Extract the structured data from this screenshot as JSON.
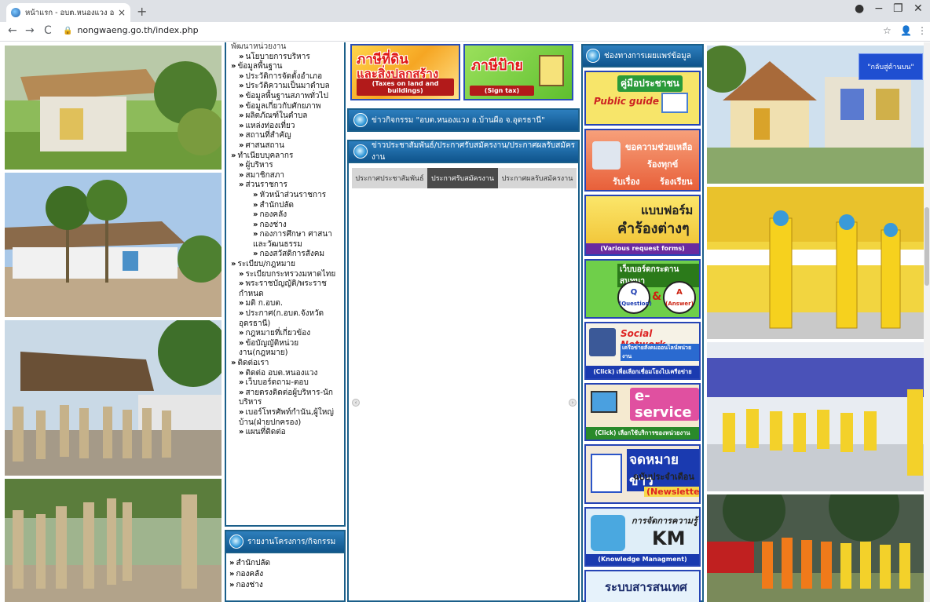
{
  "browser": {
    "tab_title": "หน้าแรก - อบต.หนองแวง อ.บ้านผือ จ.",
    "tab_close": "×",
    "new_tab": "+",
    "url": "nongwaeng.go.th/index.php",
    "min": "−",
    "restore": "❐",
    "close": "✕",
    "back": "←",
    "forward": "→",
    "reload": "C",
    "star": "☆",
    "more": "⋮"
  },
  "menu": {
    "items": [
      {
        "level": 1,
        "label": "นโยบายการบริหาร"
      },
      {
        "level": 0,
        "label": "ข้อมูลพื้นฐาน"
      },
      {
        "level": 1,
        "label": "ประวัติการจัดตั้งอำเภอ"
      },
      {
        "level": 1,
        "label": "ประวัติความเป็นมาตำบล"
      },
      {
        "level": 1,
        "label": "ข้อมูลพื้นฐานสภาพทั่วไป"
      },
      {
        "level": 1,
        "label": "ข้อมูลเกี่ยวกับศักยภาพ"
      },
      {
        "level": 1,
        "label": "ผลิตภัณฑ์ในตำบล"
      },
      {
        "level": 1,
        "label": "แหล่งท่องเที่ยว"
      },
      {
        "level": 1,
        "label": "สถานที่สำคัญ"
      },
      {
        "level": 1,
        "label": "ศาสนสถาน"
      },
      {
        "level": 0,
        "label": "ทำเนียบบุคลากร"
      },
      {
        "level": 1,
        "label": "ผู้บริหาร"
      },
      {
        "level": 1,
        "label": "สมาชิกสภา"
      },
      {
        "level": 1,
        "label": "ส่วนราชการ"
      },
      {
        "level": 2,
        "label": "หัวหน้าส่วนราชการ"
      },
      {
        "level": 2,
        "label": "สำนักปลัด"
      },
      {
        "level": 2,
        "label": "กองคลัง"
      },
      {
        "level": 2,
        "label": "กองช่าง"
      },
      {
        "level": 2,
        "label": "กองการศึกษา ศาสนาและวัฒนธรรม"
      },
      {
        "level": 2,
        "label": "กองสวัสดิการสังคม"
      },
      {
        "level": 0,
        "label": "ระเบียบ/กฎหมาย"
      },
      {
        "level": 1,
        "label": "ระเบียบกระทรวงมหาดไทย"
      },
      {
        "level": 1,
        "label": "พระราชบัญญัติ/พระราชกำหนด"
      },
      {
        "level": 1,
        "label": "มติ ก.อบต."
      },
      {
        "level": 1,
        "label": "ประกาศ(ก.อบต.จังหวัดอุดรธานี)"
      },
      {
        "level": 1,
        "label": "กฎหมายที่เกี่ยวข้อง"
      },
      {
        "level": 1,
        "label": "ข้อบัญญัติหน่วยงาน(กฎหมาย)"
      },
      {
        "level": 0,
        "label": "ติดต่อเรา"
      },
      {
        "level": 1,
        "label": "ติดต่อ อบต.หนองแวง"
      },
      {
        "level": 1,
        "label": "เว็บบอร์ดถาม-ตอบ"
      },
      {
        "level": 1,
        "label": "สายตรงติดต่อผู้บริหาร-นักบริหาร"
      },
      {
        "level": 1,
        "label": "เบอร์โทรศัพท์กำนัน,ผู้ใหญ่บ้าน(ฝ่ายปกครอง)"
      },
      {
        "level": 1,
        "label": "แผนที่ติดต่อ"
      }
    ],
    "cut_top": "พัฒนาหน่วยงาน"
  },
  "menu2": {
    "title": "รายงานโครงการ/กิจกรรม",
    "items": [
      "สำนักปลัด",
      "กองคลัง",
      "กองช่าง"
    ]
  },
  "banners": {
    "tax_land_line1": "ภาษีที่ดิน",
    "tax_land_line2": "และสิ่งปลูกสร้าง",
    "tax_land_en": "(Taxes on land and buildings)",
    "tax_sign_th": "ภาษีป้าย",
    "tax_sign_en": "(Sign tax)"
  },
  "middle": {
    "activity_title": "ข่าวกิจกรรม \"อบต.หนองแวง อ.บ้านผือ จ.อุดรธานี\"",
    "pr_title": "ข่าวประชาสัมพันธ์/ประกาศรับสมัครงาน/ประกาศผลรับสมัครงาน",
    "tabs": [
      "ประกาศประชาสัมพันธ์",
      "ประกาศรับสมัครงาน",
      "ประกาศผลรับสมัครงาน"
    ],
    "active_tab": 1,
    "prev": "‹",
    "next": "›"
  },
  "right": {
    "title": "ช่องทางการเผยแพร่ข้อมูล",
    "public_guide_th": "คู่มือประชาชน",
    "public_guide_en": "Public guide",
    "help_title": "ขอความช่วยเหลือ",
    "help_1": "ร้องทุกข์",
    "help_2": "รับเรื่อง",
    "help_3": "ร้องเรียน",
    "form_title": "แบบฟอร์ม",
    "form_big": "คำร้องต่างๆ",
    "form_en": "(Various request forms)",
    "qa_title": "เว็บบอร์ดกระดานสนทนา",
    "qa_q": "Q",
    "qa_qe": "(Question)",
    "qa_amp": "&",
    "qa_a": "A",
    "qa_ae": "(Answer)",
    "social_title": "Social Network",
    "social_sub": "เครือข่ายสังคมออนไลน์หน่วยงาน",
    "social_click": "(Click) เพื่อเลือกเชื่อมโยงไปเครือข่าย",
    "eservice": "e-service",
    "eservice_click": "(Click) เลือกใช้บริการของหน่วยงาน",
    "news_title": "จดหมายข่าว",
    "news_sub": "ฉบับประจำเดือน",
    "news_en": "(Newsletter)",
    "km_title": "การจัดการความรู้",
    "km_big": "KM",
    "km_en": "(Knowledge Managment)",
    "info_title": "ระบบสารสนเทศ"
  },
  "gotop": "\"กลับสู่ด้านบน\"",
  "colors": {
    "header_blue": "#10568c",
    "border_blue": "#1b5f8a",
    "gotop_blue": "#1f4fd1"
  }
}
